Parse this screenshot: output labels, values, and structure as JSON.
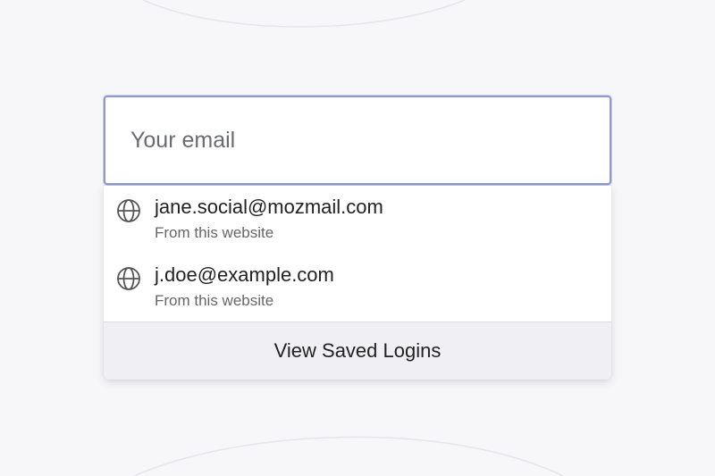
{
  "email_field": {
    "placeholder": "Your email",
    "value": ""
  },
  "autocomplete": {
    "suggestions": [
      {
        "email": "jane.social@mozmail.com",
        "source": "From this website",
        "icon": "globe-icon"
      },
      {
        "email": "j.doe@example.com",
        "source": "From this website",
        "icon": "globe-icon"
      }
    ],
    "footer_button_label": "View Saved Logins"
  },
  "colors": {
    "background": "#f7f7f9",
    "input_border": "#8e9aca",
    "footer_background": "#f0f0f4"
  }
}
